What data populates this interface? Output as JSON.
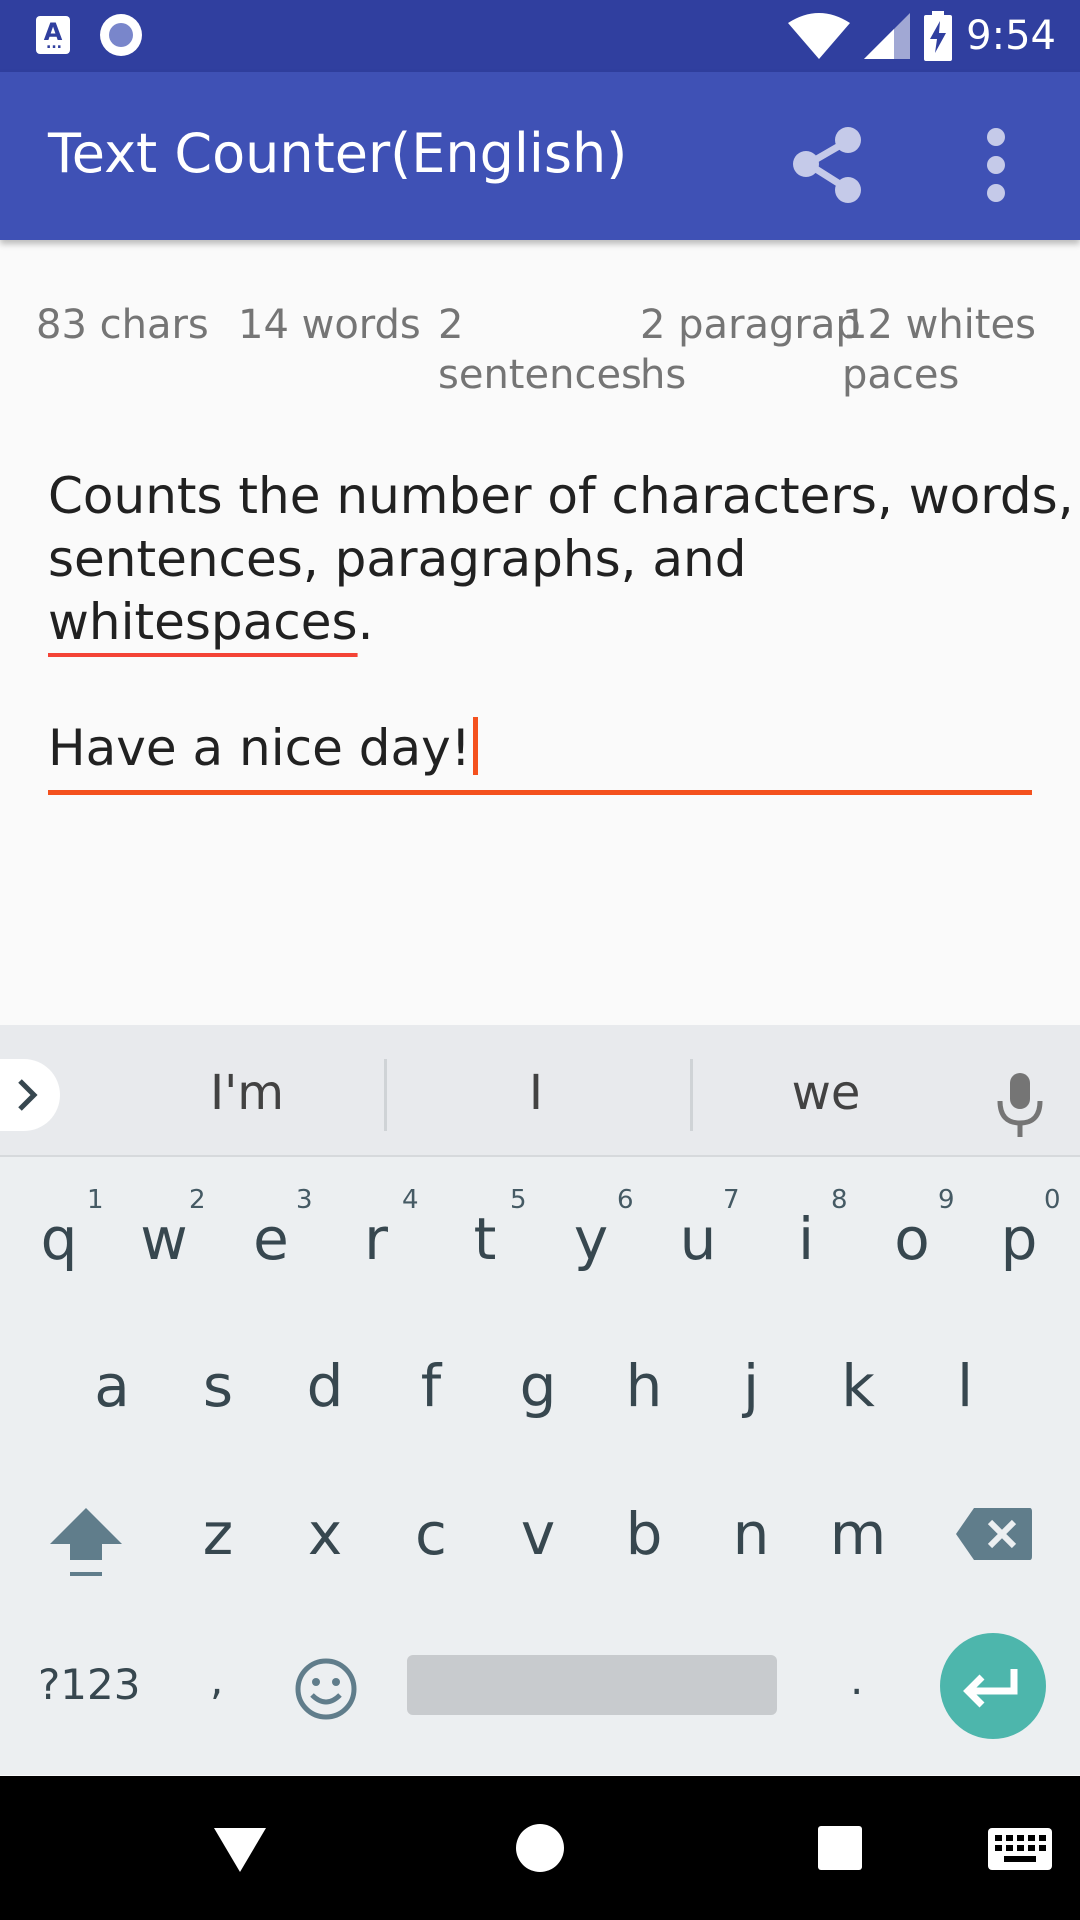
{
  "status_bar": {
    "time": "9:54",
    "left_icons": [
      "text-icon",
      "record-icon"
    ],
    "right_icons": [
      "wifi-icon",
      "signal-icon",
      "battery-charging-icon"
    ]
  },
  "toolbar": {
    "title": "Text Counter(English)",
    "share_icon": "share-icon",
    "more_icon": "more-vert-icon"
  },
  "stats": {
    "chars": [
      "83 chars"
    ],
    "words": [
      "14 words"
    ],
    "sentences": [
      "2",
      "sentences"
    ],
    "paragraphs": [
      "2 paragrap",
      "hs"
    ],
    "whitespaces": [
      "12 whites",
      "paces"
    ]
  },
  "editor": {
    "line1": "Counts the number of characters, words,",
    "line2": "sentences, paragraphs, and",
    "line3_word": "whitespaces",
    "line3_rest": ".",
    "line5": "Have a nice day!"
  },
  "keyboard": {
    "suggestions": [
      "I'm",
      "I",
      "we"
    ],
    "row1": [
      "q",
      "w",
      "e",
      "r",
      "t",
      "y",
      "u",
      "i",
      "o",
      "p"
    ],
    "row1_hints": [
      "1",
      "2",
      "3",
      "4",
      "5",
      "6",
      "7",
      "8",
      "9",
      "0"
    ],
    "row2": [
      "a",
      "s",
      "d",
      "f",
      "g",
      "h",
      "j",
      "k",
      "l"
    ],
    "row3": [
      "z",
      "x",
      "c",
      "v",
      "b",
      "n",
      "m"
    ],
    "symbols_label": "?123",
    "comma": ",",
    "period": ".",
    "accent": "#4db6ac"
  },
  "navbar": {
    "icons": [
      "back-icon",
      "home-icon",
      "recents-icon",
      "keyboard-icon"
    ]
  }
}
